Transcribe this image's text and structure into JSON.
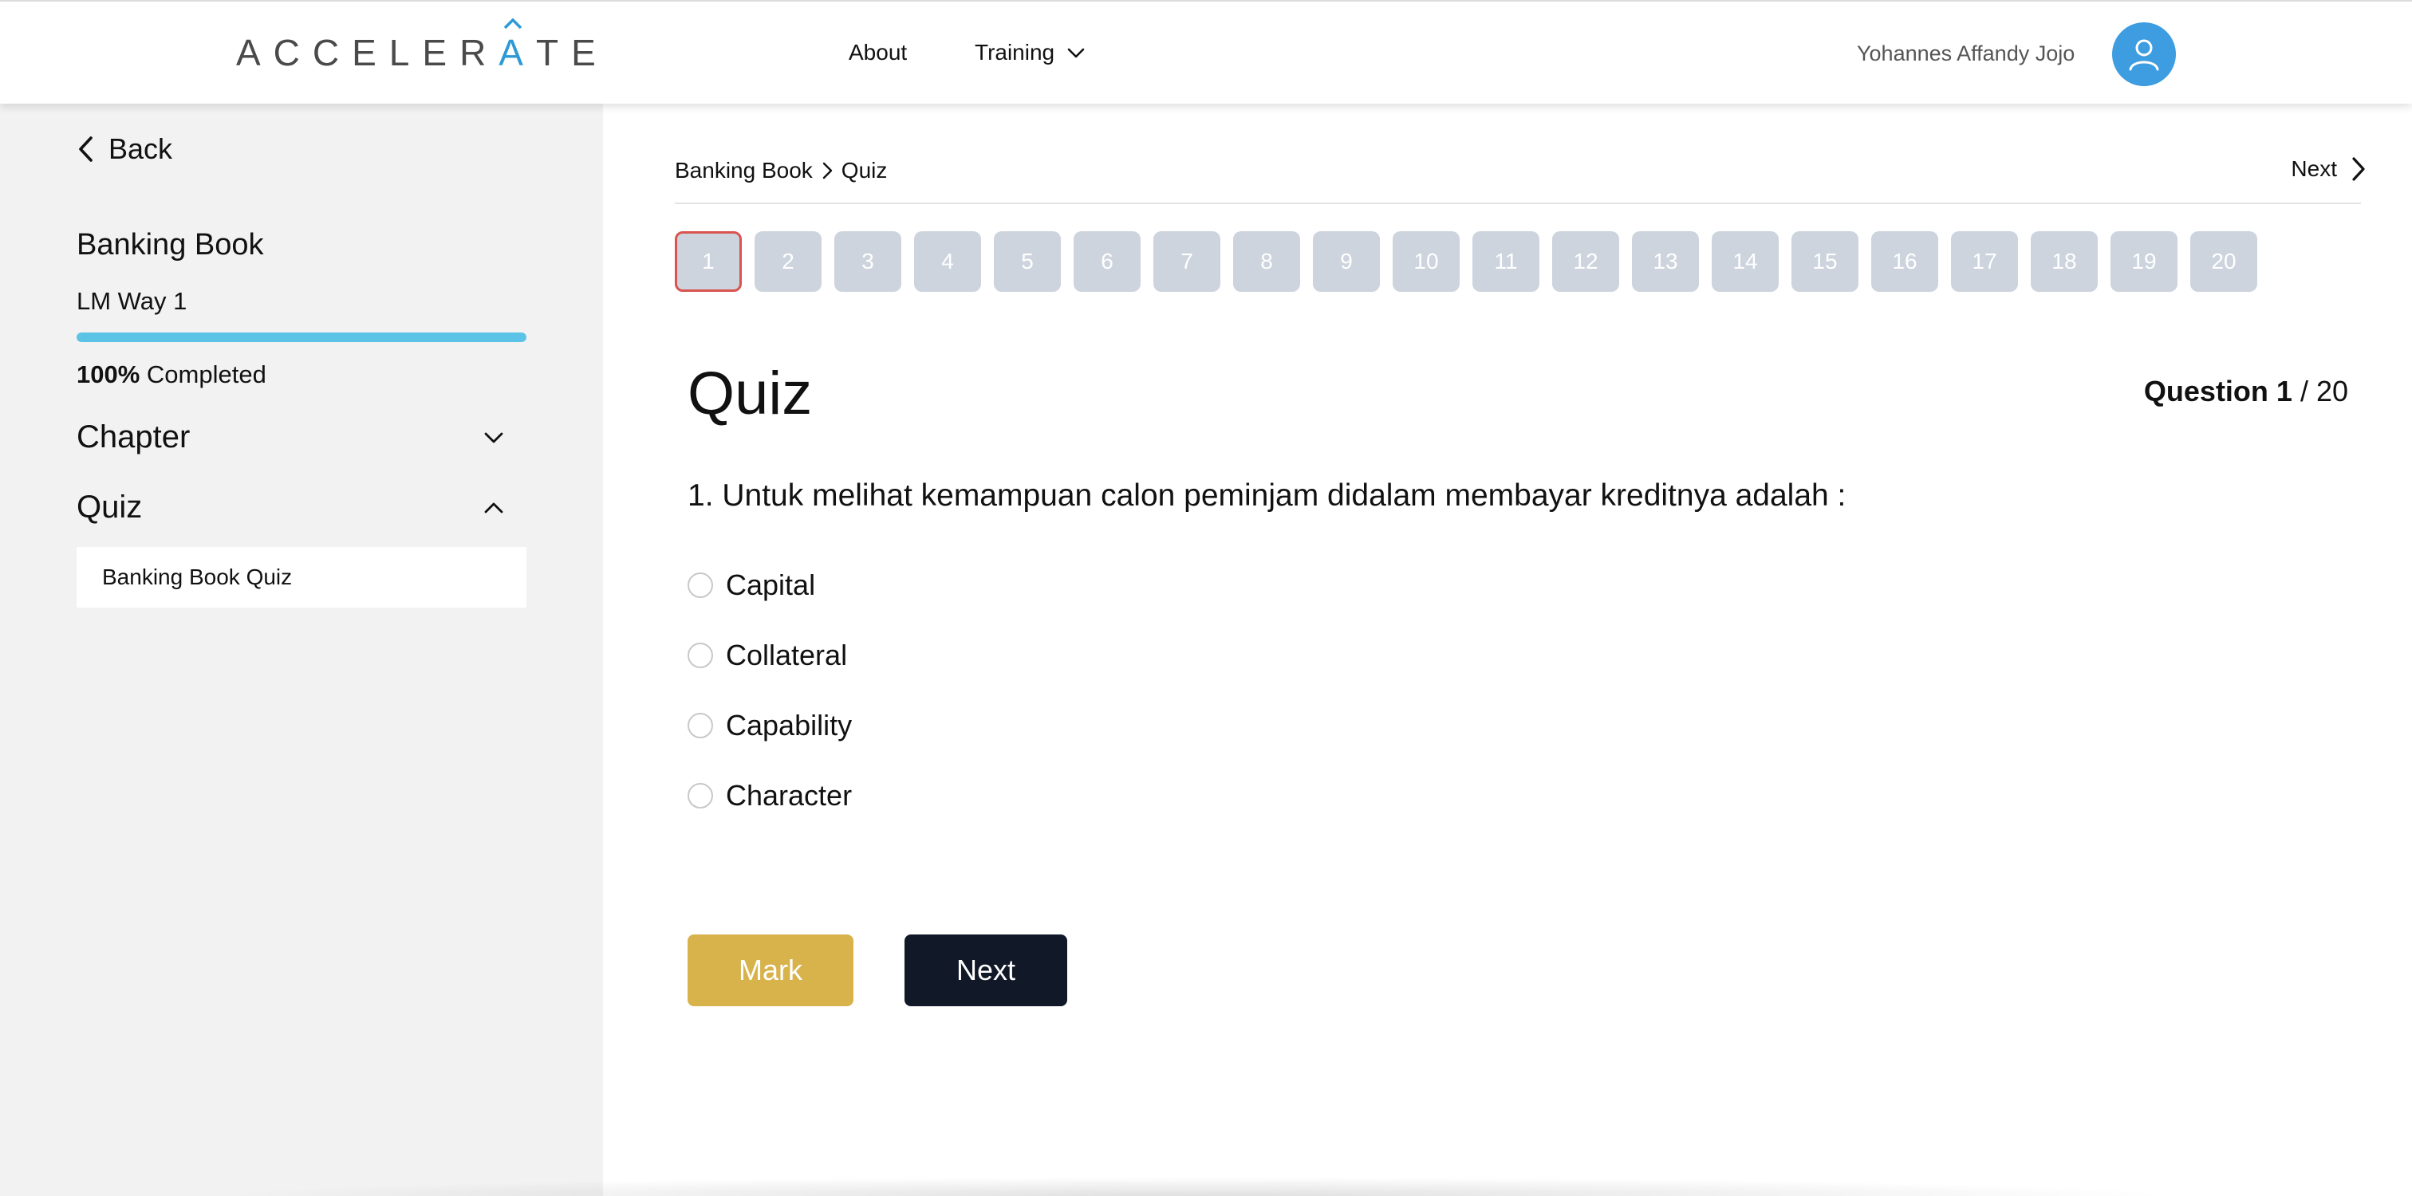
{
  "header": {
    "logo_prefix": "ACCELER",
    "logo_a": "A",
    "logo_suffix": "TE",
    "nav": {
      "about": "About",
      "training": "Training"
    },
    "user_name": "Yohannes Affandy Jojo",
    "avatar_icon": "user-icon",
    "accent_color": "#3d9de0"
  },
  "sidebar": {
    "back_label": "Back",
    "course_title": "Banking Book",
    "module_name": "LM Way 1",
    "progress": {
      "percent": 100,
      "percent_label": "100%",
      "completed_label": "Completed",
      "bar_color": "#5bc4e6"
    },
    "sections": [
      {
        "label": "Chapter",
        "expanded": false,
        "icon": "chevron-down-icon"
      },
      {
        "label": "Quiz",
        "expanded": true,
        "icon": "chevron-up-icon"
      }
    ],
    "quiz_items": [
      "Banking Book Quiz"
    ]
  },
  "main": {
    "breadcrumb": [
      "Banking Book",
      "Quiz"
    ],
    "top_next_label": "Next",
    "question_numbers": [
      "1",
      "2",
      "3",
      "4",
      "5",
      "6",
      "7",
      "8",
      "9",
      "10",
      "11",
      "12",
      "13",
      "14",
      "15",
      "16",
      "17",
      "18",
      "19",
      "20"
    ],
    "active_question": "1",
    "quiz_title": "Quiz",
    "counter": {
      "label": "Question 1",
      "separator": " / ",
      "total": "20"
    },
    "question_text": "1. Untuk melihat kemampuan calon peminjam didalam membayar kreditnya adalah :",
    "options": [
      "Capital",
      "Collateral",
      "Capability",
      "Character"
    ],
    "buttons": {
      "mark_label": "Mark",
      "next_label": "Next",
      "mark_color": "#d8b34c",
      "next_color": "#111827"
    }
  }
}
